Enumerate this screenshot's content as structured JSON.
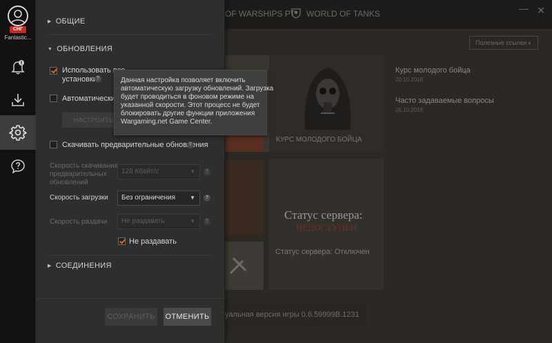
{
  "user": {
    "region": "СНГ",
    "name": "Fantastic..."
  },
  "background": {
    "tabs": [
      "OF WARSHIPS РТ",
      "WORLD OF TANKS"
    ],
    "links_dropdown": "Полезные ссылки",
    "tile_caption": "КУРС МОЛОДОГО БОЙЦА",
    "news": [
      {
        "title": "Курс молодого бойца",
        "date": "20.10.2018"
      },
      {
        "title": "Часто задаваемые вопросы",
        "date": "26.10.2018"
      }
    ],
    "server_title": "Статус сервера:",
    "server_state": "НЕДОСТУПЕН",
    "server_line": "Статус сервера: Отключен",
    "version_text": "ктуальная версия игры   0.6.59999В.1231"
  },
  "settings": {
    "general_header": "ОБЩИЕ",
    "updates_header": "ОБНОВЛЕНИЯ",
    "auto_install": {
      "label_line1": "Использовать все",
      "label_line2": "установки",
      "checked": true
    },
    "auto_limit": {
      "label": "Автоматически о",
      "checked": false
    },
    "configure_button": "НАСТРОИТЬ Р",
    "preload": {
      "label": "Скачивать предварительные обновления",
      "checked": false
    },
    "preload_speed": {
      "label_line1": "Скорость скачивания",
      "label_line2": "предварительных",
      "label_line3": "обновлений",
      "value": "128 Кбайт/с"
    },
    "download_speed": {
      "label": "Скорость загрузки",
      "value": "Без ограничения"
    },
    "upload_speed": {
      "label": "Скорость раздачи",
      "value": "Не раздавать"
    },
    "no_seed": {
      "label": "Не раздавать",
      "checked": true
    },
    "connections_header": "СОЕДИНЕНИЯ",
    "save_button": "СОХРАНИТЬ",
    "cancel_button": "ОТМЕНИТЬ"
  },
  "tooltip": {
    "lines": [
      "Данная настройка позволяет включить",
      "автоматическую загрузку обновлений. Загрузка",
      "будет проводиться в фоновом режиме на",
      "указанной скорости. Этот процесс не будет",
      "блокировать другие функции приложения",
      "Wargaming.net Game Center."
    ]
  },
  "colors": {
    "accent": "#e06a1e",
    "badge": "#c62a2a",
    "offline": "#7c2a24"
  }
}
